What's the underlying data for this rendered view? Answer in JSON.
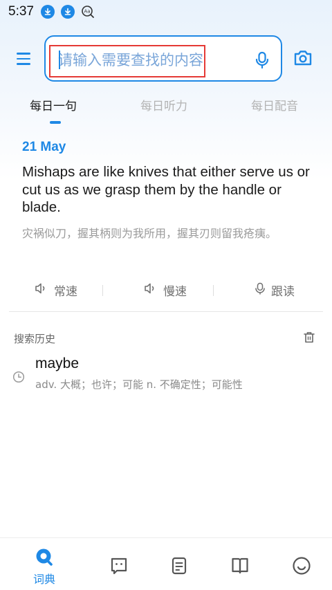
{
  "status_bar": {
    "time": "5:37",
    "icons": [
      "download-icon",
      "download-icon",
      "dictionary-app-icon"
    ]
  },
  "search": {
    "placeholder": "请输入需要查找的内容",
    "value": ""
  },
  "tabs": [
    {
      "label": "每日一句",
      "active": true
    },
    {
      "label": "每日听力",
      "active": false
    },
    {
      "label": "每日配音",
      "active": false
    }
  ],
  "daily": {
    "date": "21 May",
    "sentence_en": "Mishaps are like knives that either serve us or cut us as we grasp them by the handle or blade.",
    "sentence_zh": "灾祸似刀，握其柄则为我所用，握其刃则留我疮痍。",
    "buttons": [
      {
        "label": "常速",
        "icon": "speaker-icon"
      },
      {
        "label": "慢速",
        "icon": "speaker-icon"
      },
      {
        "label": "跟读",
        "icon": "microphone-icon"
      }
    ]
  },
  "history": {
    "title": "搜索历史",
    "items": [
      {
        "word": "maybe",
        "definition": "adv. 大概；也许；可能 n. 不确定性；可能性"
      }
    ]
  },
  "bottom_nav": {
    "items": [
      {
        "label": "词典",
        "icon": "dictionary-search-icon",
        "active": true
      },
      {
        "label": "",
        "icon": "chat-face-icon",
        "active": false
      },
      {
        "label": "",
        "icon": "notes-icon",
        "active": false
      },
      {
        "label": "",
        "icon": "book-icon",
        "active": false
      },
      {
        "label": "",
        "icon": "smiley-icon",
        "active": false
      }
    ]
  },
  "colors": {
    "accent": "#1e88e5",
    "highlight_box": "#e53935",
    "muted_text": "#9a9a9a"
  }
}
